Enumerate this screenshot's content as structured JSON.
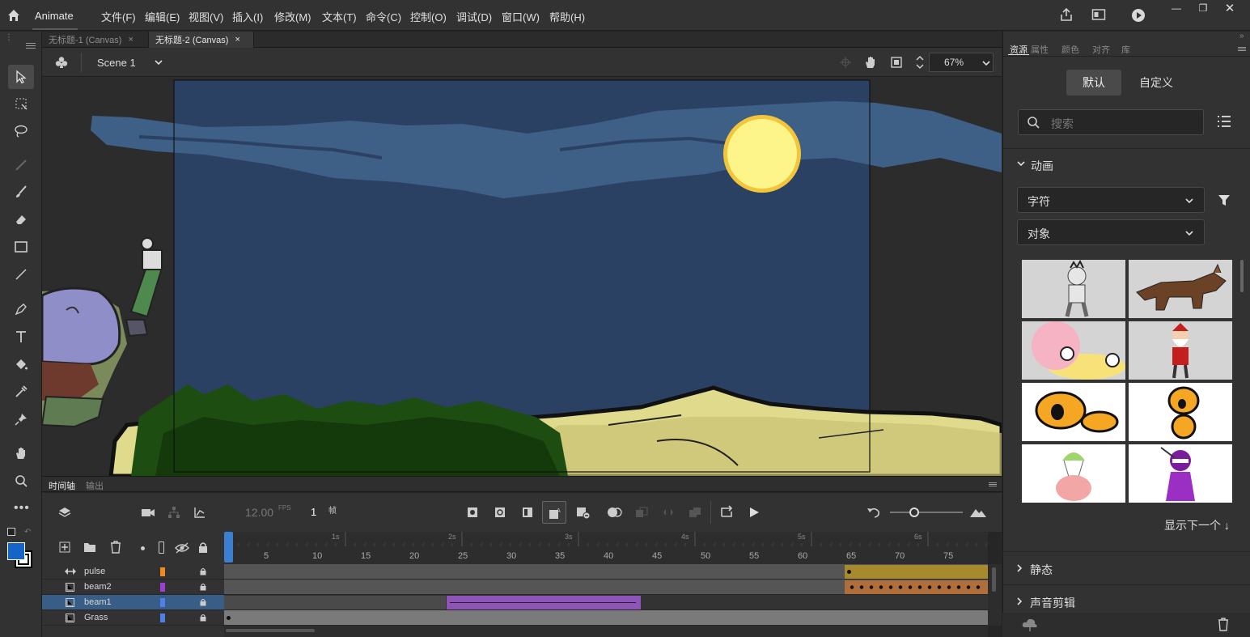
{
  "app": {
    "name": "Animate"
  },
  "menu": [
    "文件(F)",
    "编辑(E)",
    "视图(V)",
    "插入(I)",
    "修改(M)",
    "文本(T)",
    "命令(C)",
    "控制(O)",
    "调试(D)",
    "窗口(W)",
    "帮助(H)"
  ],
  "tabs": [
    {
      "label": "无标题-1 (Canvas)",
      "close": "×"
    },
    {
      "label": "无标题-2 (Canvas)",
      "close": "×"
    }
  ],
  "scene": {
    "name": "Scene 1",
    "zoom": "67%"
  },
  "timeline": {
    "tabs": [
      "时间轴",
      "输出"
    ],
    "fps": "12.00",
    "fps_unit": "FPS",
    "frame": "1",
    "frame_unit": "帧",
    "seconds": [
      "1s",
      "2s",
      "3s",
      "4s",
      "5s",
      "6s"
    ],
    "frame_numbers": [
      "5",
      "10",
      "15",
      "20",
      "25",
      "30",
      "35",
      "40",
      "45",
      "50",
      "55",
      "60",
      "65",
      "70",
      "75"
    ],
    "layers": [
      {
        "name": "pulse",
        "color": "#f08a1e"
      },
      {
        "name": "beam2",
        "color": "#9b3fd6"
      },
      {
        "name": "beam1",
        "color": "#4f7fe8"
      },
      {
        "name": "Grass",
        "color": "#4f7fe8"
      }
    ]
  },
  "assets": {
    "tabs": [
      "资源",
      "属性",
      "颜色",
      "对齐",
      "库"
    ],
    "toggle": [
      "默认",
      "自定义"
    ],
    "search_placeholder": "搜索",
    "section_animation": "动画",
    "dropdown1": "字符",
    "dropdown2": "对象",
    "show_next": "显示下一个 ↓",
    "section_static": "静态",
    "section_sound": "声音剪辑"
  },
  "colors": {
    "stroke": "#000000",
    "fill": "#1565c8",
    "accent": "#4a8de0"
  }
}
